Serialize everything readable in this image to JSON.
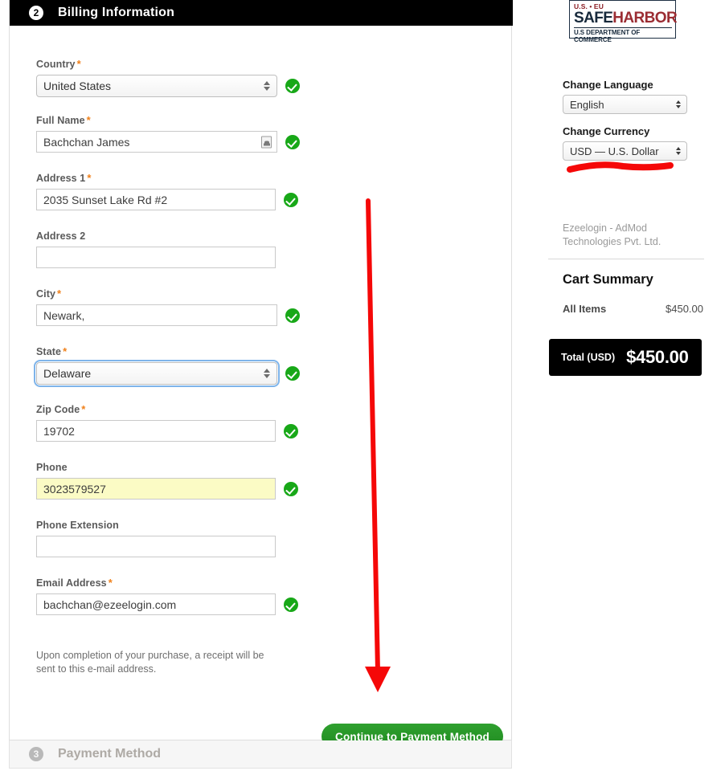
{
  "step": {
    "number": "2",
    "title": "Billing Information"
  },
  "fields": {
    "country": {
      "label": "Country",
      "required": "*",
      "value": "United States",
      "valid": true
    },
    "full_name": {
      "label": "Full Name",
      "required": "*",
      "value": "Bachchan James",
      "placeholder": "",
      "valid": true,
      "icon": "autofill-contact-card-icon"
    },
    "address1": {
      "label": "Address 1",
      "required": "*",
      "value": "2035 Sunset Lake Rd #2",
      "placeholder": "",
      "valid": true
    },
    "address2": {
      "label": "Address 2",
      "required": "",
      "value": "",
      "placeholder": "",
      "valid": false
    },
    "city": {
      "label": "City",
      "required": "*",
      "value": "Newark,",
      "placeholder": "",
      "valid": true
    },
    "state": {
      "label": "State",
      "required": "*",
      "value": "Delaware",
      "valid": true,
      "focused": true
    },
    "zip": {
      "label": "Zip Code",
      "required": "*",
      "value": "19702",
      "placeholder": "",
      "valid": true
    },
    "phone": {
      "label": "Phone",
      "required": "",
      "value": "3023579527",
      "placeholder": "",
      "valid": true,
      "autofilled": true
    },
    "phone_ext": {
      "label": "Phone Extension",
      "required": "",
      "value": "",
      "placeholder": "",
      "valid": false
    },
    "email": {
      "label": "Email Address",
      "required": "*",
      "value": "bachchan@ezeelogin.com",
      "placeholder": "",
      "valid": true
    }
  },
  "email_note": "Upon completion of your purchase, a receipt will be sent to this e-mail address.",
  "continue_button": "Continue to Payment Method",
  "step3": {
    "number": "3",
    "title": "Payment Method"
  },
  "sidebar": {
    "safeharbor": {
      "top": "U.S. • EU",
      "safe": "SAFE",
      "harbor": "HARBOR",
      "bottom": "U.S DEPARTMENT OF COMMERCE"
    },
    "language": {
      "label": "Change Language",
      "value": "English"
    },
    "currency": {
      "label": "Change Currency",
      "value": "USD — U.S. Dollar"
    },
    "company": "Ezeelogin - AdMod Technologies Pvt. Ltd.",
    "cart": {
      "title": "Cart Summary",
      "items_label": "All Items",
      "items_value": "$450.00",
      "total_label": "Total (USD)",
      "total_value": "$450.00"
    }
  },
  "annotations": {
    "arrow_color": "#f50808",
    "underline_color": "#f50808"
  },
  "colors": {
    "header_bg": "#000000",
    "accent_required": "#f0801a",
    "valid_green": "#18a818",
    "button_green": "#2fa02f",
    "autofill_yellow": "#fbfbc5",
    "focus_blue": "#7eb4ea"
  }
}
